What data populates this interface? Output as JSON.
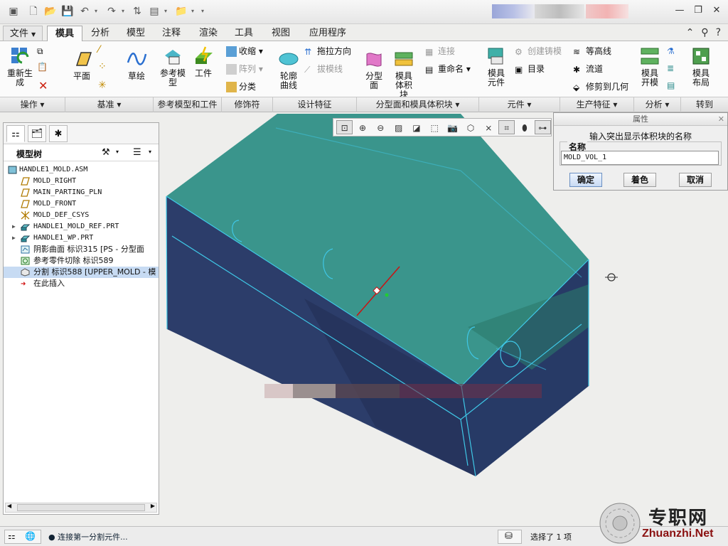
{
  "tabs": [
    "文件",
    "模具",
    "分析",
    "模型",
    "注释",
    "渲染",
    "工具",
    "视图",
    "应用程序"
  ],
  "file_arrow": "▼",
  "ribbon": {
    "regen_label": "重新生成",
    "plane_label": "平面",
    "sketch_label": "草绘",
    "refmodel_label": "参考模型",
    "workpiece_label": "工件",
    "shrink_label": "收缩",
    "pattern_label": "阵列",
    "classify_label": "分类",
    "contour_label": "轮廓曲线",
    "draw_dir_label": "拖拉方向",
    "draft_label": "拔模线",
    "parting_label": "分型面",
    "mold_volume_label": "模具体积块",
    "connect_label": "连接",
    "rename_label": "重命名",
    "mold_comp_label": "模具元件",
    "create_casting_label": "创建铸模",
    "catalog_label": "目录",
    "contour_lines_label": "等高线",
    "flow_label": "流道",
    "trim_label": "修剪到几何",
    "mold_open_label": "模具开模",
    "mold_layout_label": "模具布局"
  },
  "groups": [
    "操作",
    "基准",
    "参考模型和工件",
    "修饰符",
    "设计特征",
    "分型面和模具体积块",
    "元件",
    "生产特征",
    "分析",
    "转到"
  ],
  "model_tree": {
    "title": "模型树",
    "items": [
      {
        "label": "HANDLE1_MOLD.ASM",
        "icon": "assembly-icon"
      },
      {
        "label": "MOLD_RIGHT",
        "icon": "datum-plane-icon"
      },
      {
        "label": "MAIN_PARTING_PLN",
        "icon": "datum-plane-icon"
      },
      {
        "label": "MOLD_FRONT",
        "icon": "datum-plane-icon"
      },
      {
        "label": "MOLD_DEF_CSYS",
        "icon": "csys-icon"
      },
      {
        "label": "HANDLE1_MOLD_REF.PRT",
        "icon": "part-icon"
      },
      {
        "label": "HANDLE1_WP.PRT",
        "icon": "part-icon"
      },
      {
        "label": "阴影曲面 标识315 [PS - 分型面",
        "icon": "surface-icon"
      },
      {
        "label": "参考零件切除 标识589",
        "icon": "cut-icon"
      },
      {
        "label": "分割 标识588 [UPPER_MOLD - 模",
        "icon": "split-icon"
      },
      {
        "label": "在此插入",
        "icon": "insert-arrow-icon"
      }
    ]
  },
  "dialog": {
    "title": "属性",
    "prompt": "输入突出显示体积块的名称",
    "field_label": "名称",
    "name_value": "MOLD_VOL_1",
    "ok_label": "确定",
    "color_label": "着色",
    "cancel_label": "取消"
  },
  "status": {
    "message": "● 连接第一分割元件...",
    "selection": "选择了 1 项"
  },
  "watermark": {
    "cn": "专职网",
    "en": "Zhuanzhi.Net"
  },
  "colors": {
    "model_top": "#3a958c",
    "model_front": "#2c3d6a",
    "edge": "#3fc7e6",
    "accent": "#cc1111"
  }
}
